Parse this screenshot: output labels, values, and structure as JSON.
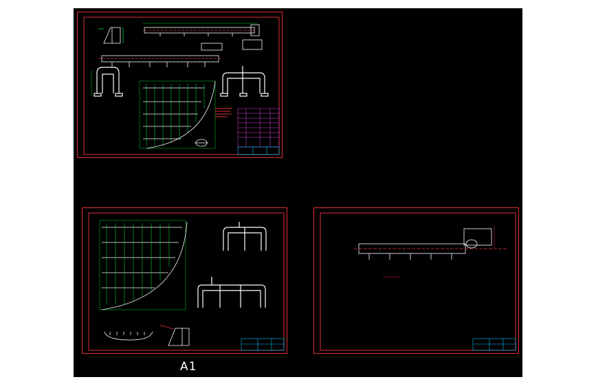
{
  "viewer": {
    "background": "#ffffff",
    "canvas_color": "#000000"
  },
  "drawing": {
    "sheet_label": "A1",
    "colors": {
      "border": "#e0303a",
      "geometry": "#ffffff",
      "dimension": "#00d23c",
      "centerline": "#e0303a",
      "title_block": "#00c8ff",
      "table": "#e040e0",
      "note": "#e0303a"
    },
    "sheets": [
      {
        "id": "sheet-top-left",
        "contents": [
          "tank-section-view",
          "manifold-header-top",
          "manifold-header-bottom",
          "u-pipe-assembly",
          "tube-bundle-grid",
          "parts-table",
          "title-block"
        ]
      },
      {
        "id": "sheet-bottom-left",
        "contents": [
          "tube-bundle-grid",
          "u-pipe-assembly",
          "u-pipe-assembly-wide",
          "curved-base-profile",
          "tank-section-view",
          "title-block"
        ]
      },
      {
        "id": "sheet-bottom-right",
        "contents": [
          "manifold-header",
          "title-block"
        ]
      }
    ]
  }
}
